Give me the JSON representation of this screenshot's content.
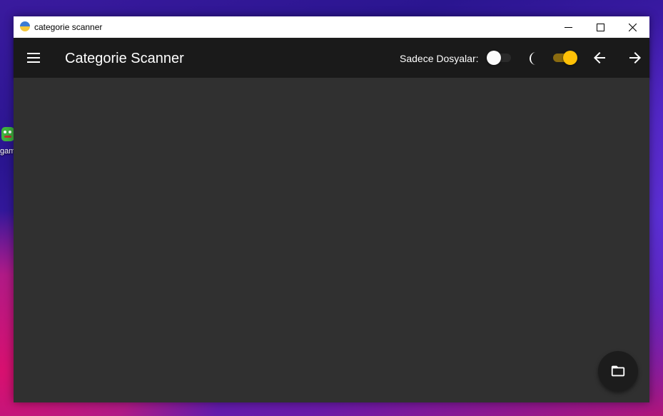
{
  "desktop": {
    "icon_label": "gam"
  },
  "window": {
    "title": "categorie scanner",
    "controls": [
      "minimize",
      "maximize",
      "close"
    ]
  },
  "appbar": {
    "menu_icon": "hamburger-menu-icon",
    "title": "Categorie Scanner",
    "files_only_label": "Sadece Dosyalar:",
    "files_only_enabled": false,
    "theme_icon": "moon-icon",
    "dark_mode_enabled": true,
    "back_icon": "arrow-left-icon",
    "forward_icon": "arrow-right-icon"
  },
  "fab": {
    "icon": "folder-icon"
  },
  "colors": {
    "appbar_bg": "#1a1a1a",
    "content_bg": "#303030",
    "accent": "#ffc107",
    "accent_track": "#8a6b10"
  }
}
